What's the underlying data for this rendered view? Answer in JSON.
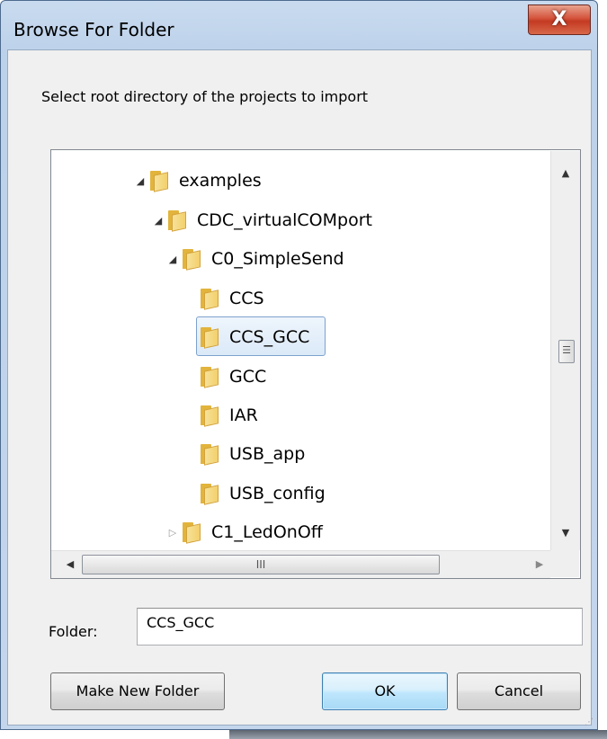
{
  "window": {
    "title": "Browse For Folder",
    "close_glyph": "X"
  },
  "prompt": "Select root directory of the projects to import",
  "tree": {
    "items": [
      {
        "label": "examples",
        "expander": "◢"
      },
      {
        "label": "CDC_virtualCOMport",
        "expander": "◢"
      },
      {
        "label": "C0_SimpleSend",
        "expander": "◢"
      },
      {
        "label": "CCS",
        "expander": ""
      },
      {
        "label": "CCS_GCC",
        "expander": ""
      },
      {
        "label": "GCC",
        "expander": ""
      },
      {
        "label": "IAR",
        "expander": ""
      },
      {
        "label": "USB_app",
        "expander": ""
      },
      {
        "label": "USB_config",
        "expander": ""
      },
      {
        "label": "C1_LedOnOff",
        "expander": "▷"
      }
    ],
    "selected": "CCS_GCC"
  },
  "scrollbars": {
    "up": "▲",
    "down": "▼",
    "left": "◀",
    "right": "▶",
    "v_thumb_grip": "☰",
    "h_thumb_grip": "III"
  },
  "folder_field": {
    "label": "Folder:",
    "value": "CCS_GCC"
  },
  "buttons": {
    "make_new_folder": "Make New Folder",
    "ok": "OK",
    "cancel": "Cancel"
  },
  "colors": {
    "title_bar": "#c9dbef",
    "close_button": "#c33a22",
    "selection_border": "#7da2ce",
    "default_button": "#3c7fb1"
  }
}
